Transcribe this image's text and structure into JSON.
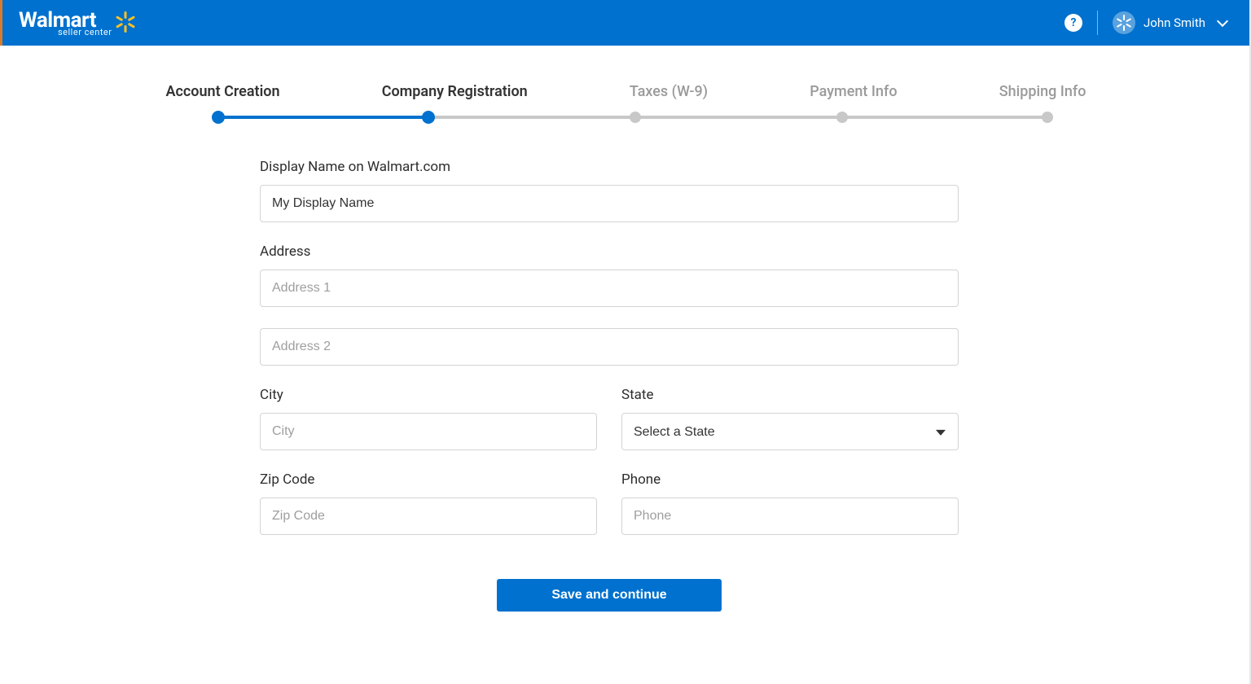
{
  "header": {
    "brand": "Walmart",
    "brand_sub": "seller center",
    "help_char": "?",
    "user_name": "John Smith"
  },
  "stepper": {
    "steps": [
      {
        "label": "Account Creation",
        "state": "done"
      },
      {
        "label": "Company Registration",
        "state": "active"
      },
      {
        "label": "Taxes (W-9)",
        "state": "pending"
      },
      {
        "label": "Payment Info",
        "state": "pending"
      },
      {
        "label": "Shipping Info",
        "state": "pending"
      }
    ]
  },
  "form": {
    "display_name_label": "Display Name on Walmart.com",
    "display_name_value": "My Display Name",
    "address_label": "Address",
    "address1_placeholder": "Address 1",
    "address2_placeholder": "Address 2",
    "city_label": "City",
    "city_placeholder": "City",
    "state_label": "State",
    "state_placeholder": "Select a State",
    "zip_label": "Zip Code",
    "zip_placeholder": "Zip Code",
    "phone_label": "Phone",
    "phone_placeholder": "Phone",
    "save_button": "Save and continue"
  },
  "colors": {
    "brand_blue": "#0071ce",
    "spark_yellow": "#ffc220",
    "inactive_grey": "#c8c8c8"
  }
}
